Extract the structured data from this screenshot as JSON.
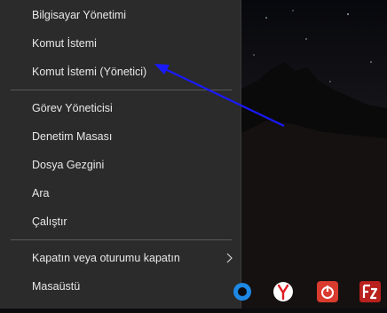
{
  "menu": {
    "items": [
      {
        "label": "Bilgisayar Yönetimi"
      },
      {
        "label": "Komut İstemi"
      },
      {
        "label": "Komut İstemi (Yönetici)"
      },
      {
        "label": "Görev Yöneticisi"
      },
      {
        "label": "Denetim Masası"
      },
      {
        "label": "Dosya Gezgini"
      },
      {
        "label": "Ara"
      },
      {
        "label": "Çalıştır"
      },
      {
        "label": "Kapatın veya oturumu kapatın"
      },
      {
        "label": "Masaüstü"
      }
    ]
  },
  "taskbar": {
    "icons": [
      "edge-icon",
      "yandex-browser-icon",
      "power-app-icon",
      "filezilla-icon"
    ]
  },
  "colors": {
    "menu_bg": "#2b2b2b",
    "menu_text": "#e8e8e8",
    "annotation_arrow": "#1a1aff"
  }
}
